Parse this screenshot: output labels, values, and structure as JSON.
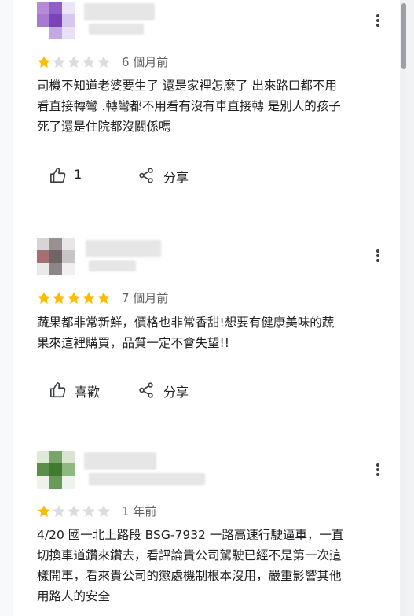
{
  "left_fragments": [
    "",
    "",
    "",
    ""
  ],
  "reviews": [
    {
      "rating": 1,
      "date": "6 個月前",
      "text": "司機不知道老婆要生了 還是家裡怎麼了 出來路口都不用\n看直接轉彎 .轉彎都不用看有沒有車直接轉 是別人的孩子\n死了還是住院都沒關係嗎",
      "like_label": "1",
      "share_label": "分享",
      "avatar_colors": [
        "#b58ad9",
        "#8f5ec7",
        "#ece4f7",
        "#a97ad2",
        "#7a43b8",
        "#d7c6ee",
        "#ffffff",
        "#c4a8e3",
        "#e9e0f5"
      ]
    },
    {
      "rating": 5,
      "date": "7 個月前",
      "text": "蔬果都非常新鮮，價格也非常香甜!想要有健康美味的蔬\n果來這裡購買，品質一定不會失望!!",
      "like_label": "喜歡",
      "share_label": "分享",
      "avatar_colors": [
        "#d8d4d6",
        "#9a8f91",
        "#e9e6e6",
        "#a86f72",
        "#6f6466",
        "#c9c4c5",
        "#ebe8e9",
        "#8d8587",
        "#f1efef"
      ]
    },
    {
      "rating": 1,
      "date": "1 年前",
      "text": "4/20 國一北上路段 BSG-7932 一路高速行駛逼車，一直\n切換車道鑽來鑽去，看評論貴公司駕駛已經不是第一次這\n樣開車，看來貴公司的懲處機制根本沒用，嚴重影響其他\n用路人的安全",
      "like_label": "",
      "share_label": "",
      "avatar_colors": [
        "#dfe9d8",
        "#7aa56a",
        "#d9e5d2",
        "#5c8d4a",
        "#3f7a2f",
        "#8fb780",
        "#edf2ea",
        "#6a9a58",
        "#eef3ec"
      ]
    }
  ],
  "colors": {
    "star_filled": "#fbbc04",
    "star_empty": "#dadce0",
    "text": "#202124",
    "secondary": "#5f6368"
  },
  "icons": {
    "more": "more-vert-icon",
    "like": "thumb-up-icon",
    "share": "share-icon"
  }
}
